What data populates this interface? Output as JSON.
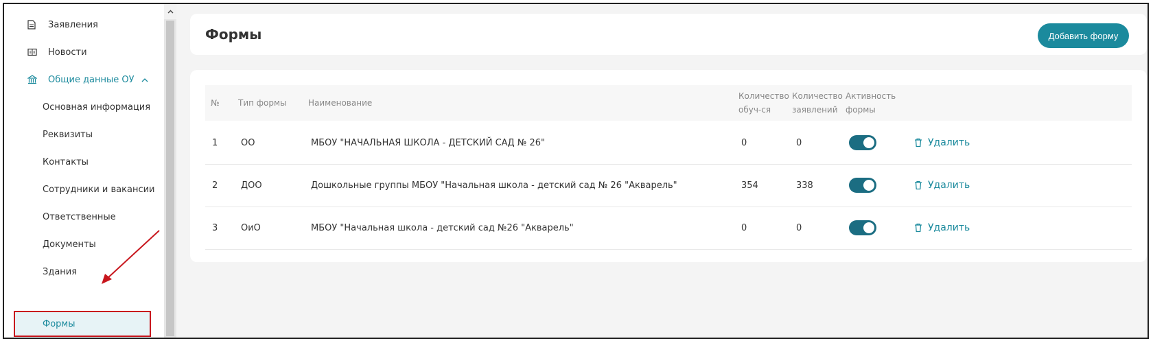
{
  "sidebar": {
    "items": [
      {
        "label": "Заявления",
        "icon": "document-icon"
      },
      {
        "label": "Новости",
        "icon": "newspaper-icon"
      },
      {
        "label": "Общие данные ОУ",
        "icon": "building-icon"
      },
      {
        "label": "Основная информация"
      },
      {
        "label": "Реквизиты"
      },
      {
        "label": "Контакты"
      },
      {
        "label": "Сотрудники и вакансии"
      },
      {
        "label": "Ответственные"
      },
      {
        "label": "Документы"
      },
      {
        "label": "Здания"
      },
      {
        "label": "Формы"
      }
    ]
  },
  "header": {
    "title": "Формы",
    "add_button": "Добавить форму"
  },
  "table": {
    "columns": {
      "num": "№",
      "type": "Тип формы",
      "name": "Наименование",
      "students_1": "Количество",
      "students_2": "обуч-ся",
      "apps_1": "Количество",
      "apps_2": "заявлений",
      "active_1": "Активность",
      "active_2": "формы"
    },
    "rows": [
      {
        "num": "1",
        "type": "ОО",
        "name": "МБОУ \"НАЧАЛЬНАЯ ШКОЛА - ДЕТСКИЙ САД № 26\"",
        "students": "0",
        "apps": "0",
        "active": true,
        "delete": "Удалить"
      },
      {
        "num": "2",
        "type": "ДОО",
        "name": "Дошкольные группы МБОУ \"Начальная школа - детский сад № 26 \"Акварель\"",
        "students": "354",
        "apps": "338",
        "active": true,
        "delete": "Удалить"
      },
      {
        "num": "3",
        "type": "ОиО",
        "name": "МБОУ \"Начальная школа - детский сад №26 \"Акварель\"",
        "students": "0",
        "apps": "0",
        "active": true,
        "delete": "Удалить"
      }
    ]
  },
  "colors": {
    "accent": "#1b8a9d",
    "toggle_on": "#1b6d82",
    "annotation": "#c8161d"
  }
}
